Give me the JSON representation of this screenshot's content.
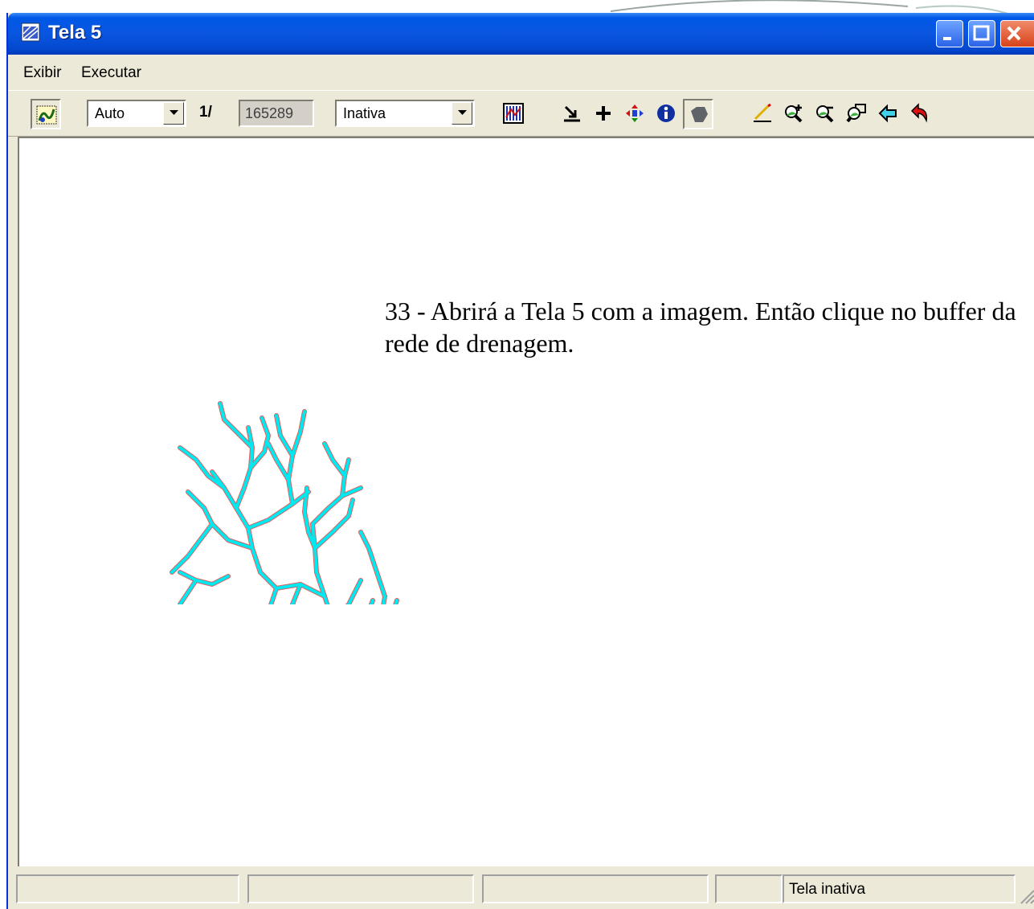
{
  "window": {
    "title": "Tela 5",
    "title_bar_color": "#0a56e0",
    "buttons": [
      "minimize-icon",
      "maximize-icon",
      "close-icon"
    ]
  },
  "menu": {
    "items": [
      {
        "label": "Exibir"
      },
      {
        "label": "Executar"
      }
    ]
  },
  "toolbar": {
    "zoom_mode": "Auto",
    "scale_prefix": "1/",
    "scale_value": "165289",
    "state_select": "Inativa",
    "tools": [
      "display-layers-icon",
      "histogram-icon",
      "select-arrow-icon",
      "crosshair-icon",
      "pan-icon",
      "info-icon",
      "tag-icon",
      "draw-line-icon",
      "zoom-in-icon",
      "zoom-out-icon",
      "zoom-window-icon",
      "previous-view-icon",
      "undo-icon"
    ]
  },
  "canvas": {
    "note": "33 -  Abrirá a Tela 5 com a imagem. Então clique no buffer da rede de drenagem.",
    "drainage_color": "#00e8f0",
    "drainage_edge_color": "#e06060"
  },
  "statusbar": {
    "panes": [
      "",
      "",
      "",
      "",
      "Tela inativa"
    ]
  }
}
